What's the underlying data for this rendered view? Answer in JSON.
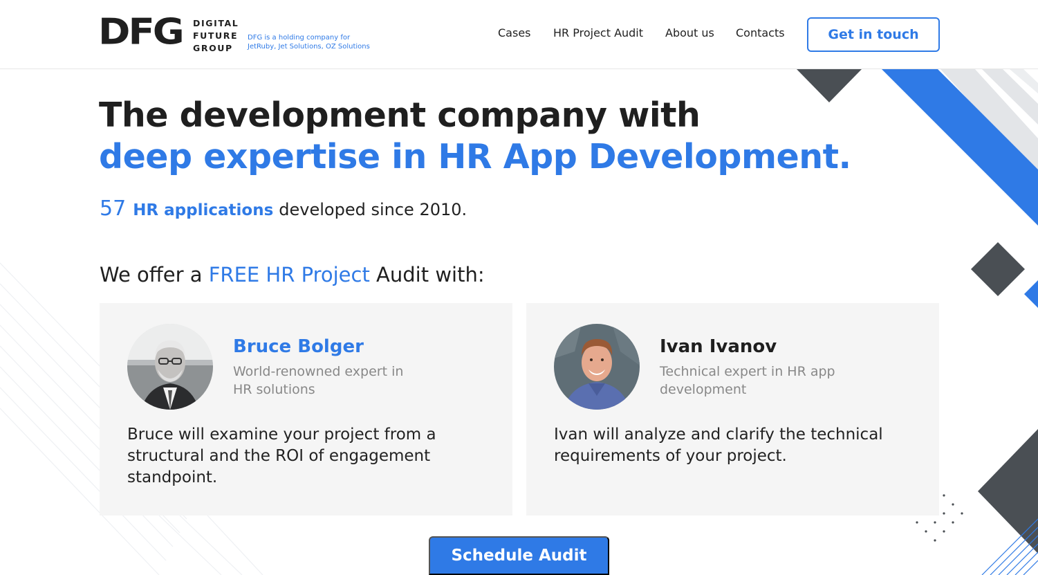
{
  "brand": {
    "logo_mark": "DFG",
    "logo_lines": [
      "DIGITAL",
      "FUTURE",
      "GROUP"
    ],
    "tagline": "DFG is a holding company for JetRuby, Jet Solutions, OZ Solutions"
  },
  "nav": {
    "items": [
      "Cases",
      "HR Project Audit",
      "About us",
      "Contacts"
    ],
    "cta_label": "Get in touch"
  },
  "hero": {
    "line1": "The development company with",
    "line2": "deep expertise in HR App Development.",
    "stat_number": "57",
    "stat_label": "HR applications",
    "stat_rest": "developed since 2010."
  },
  "offer": {
    "prefix": "We offer a ",
    "highlight": "FREE HR Project",
    "suffix": " Audit with:"
  },
  "experts": [
    {
      "name": "Bruce Bolger",
      "role": "World-renowned expert in HR solutions",
      "description": "Bruce will examine your project from a structural and the ROI of engagement standpoint."
    },
    {
      "name": "Ivan Ivanov",
      "role": "Technical expert in HR app development",
      "description": "Ivan will analyze and clarify the technical requirements of your project."
    }
  ],
  "schedule_label": "Schedule Audit",
  "colors": {
    "accent": "#2f7ae6",
    "dark": "#1f1f1f",
    "deco_dark": "#4a4f54",
    "card_bg": "#f5f5f5"
  }
}
